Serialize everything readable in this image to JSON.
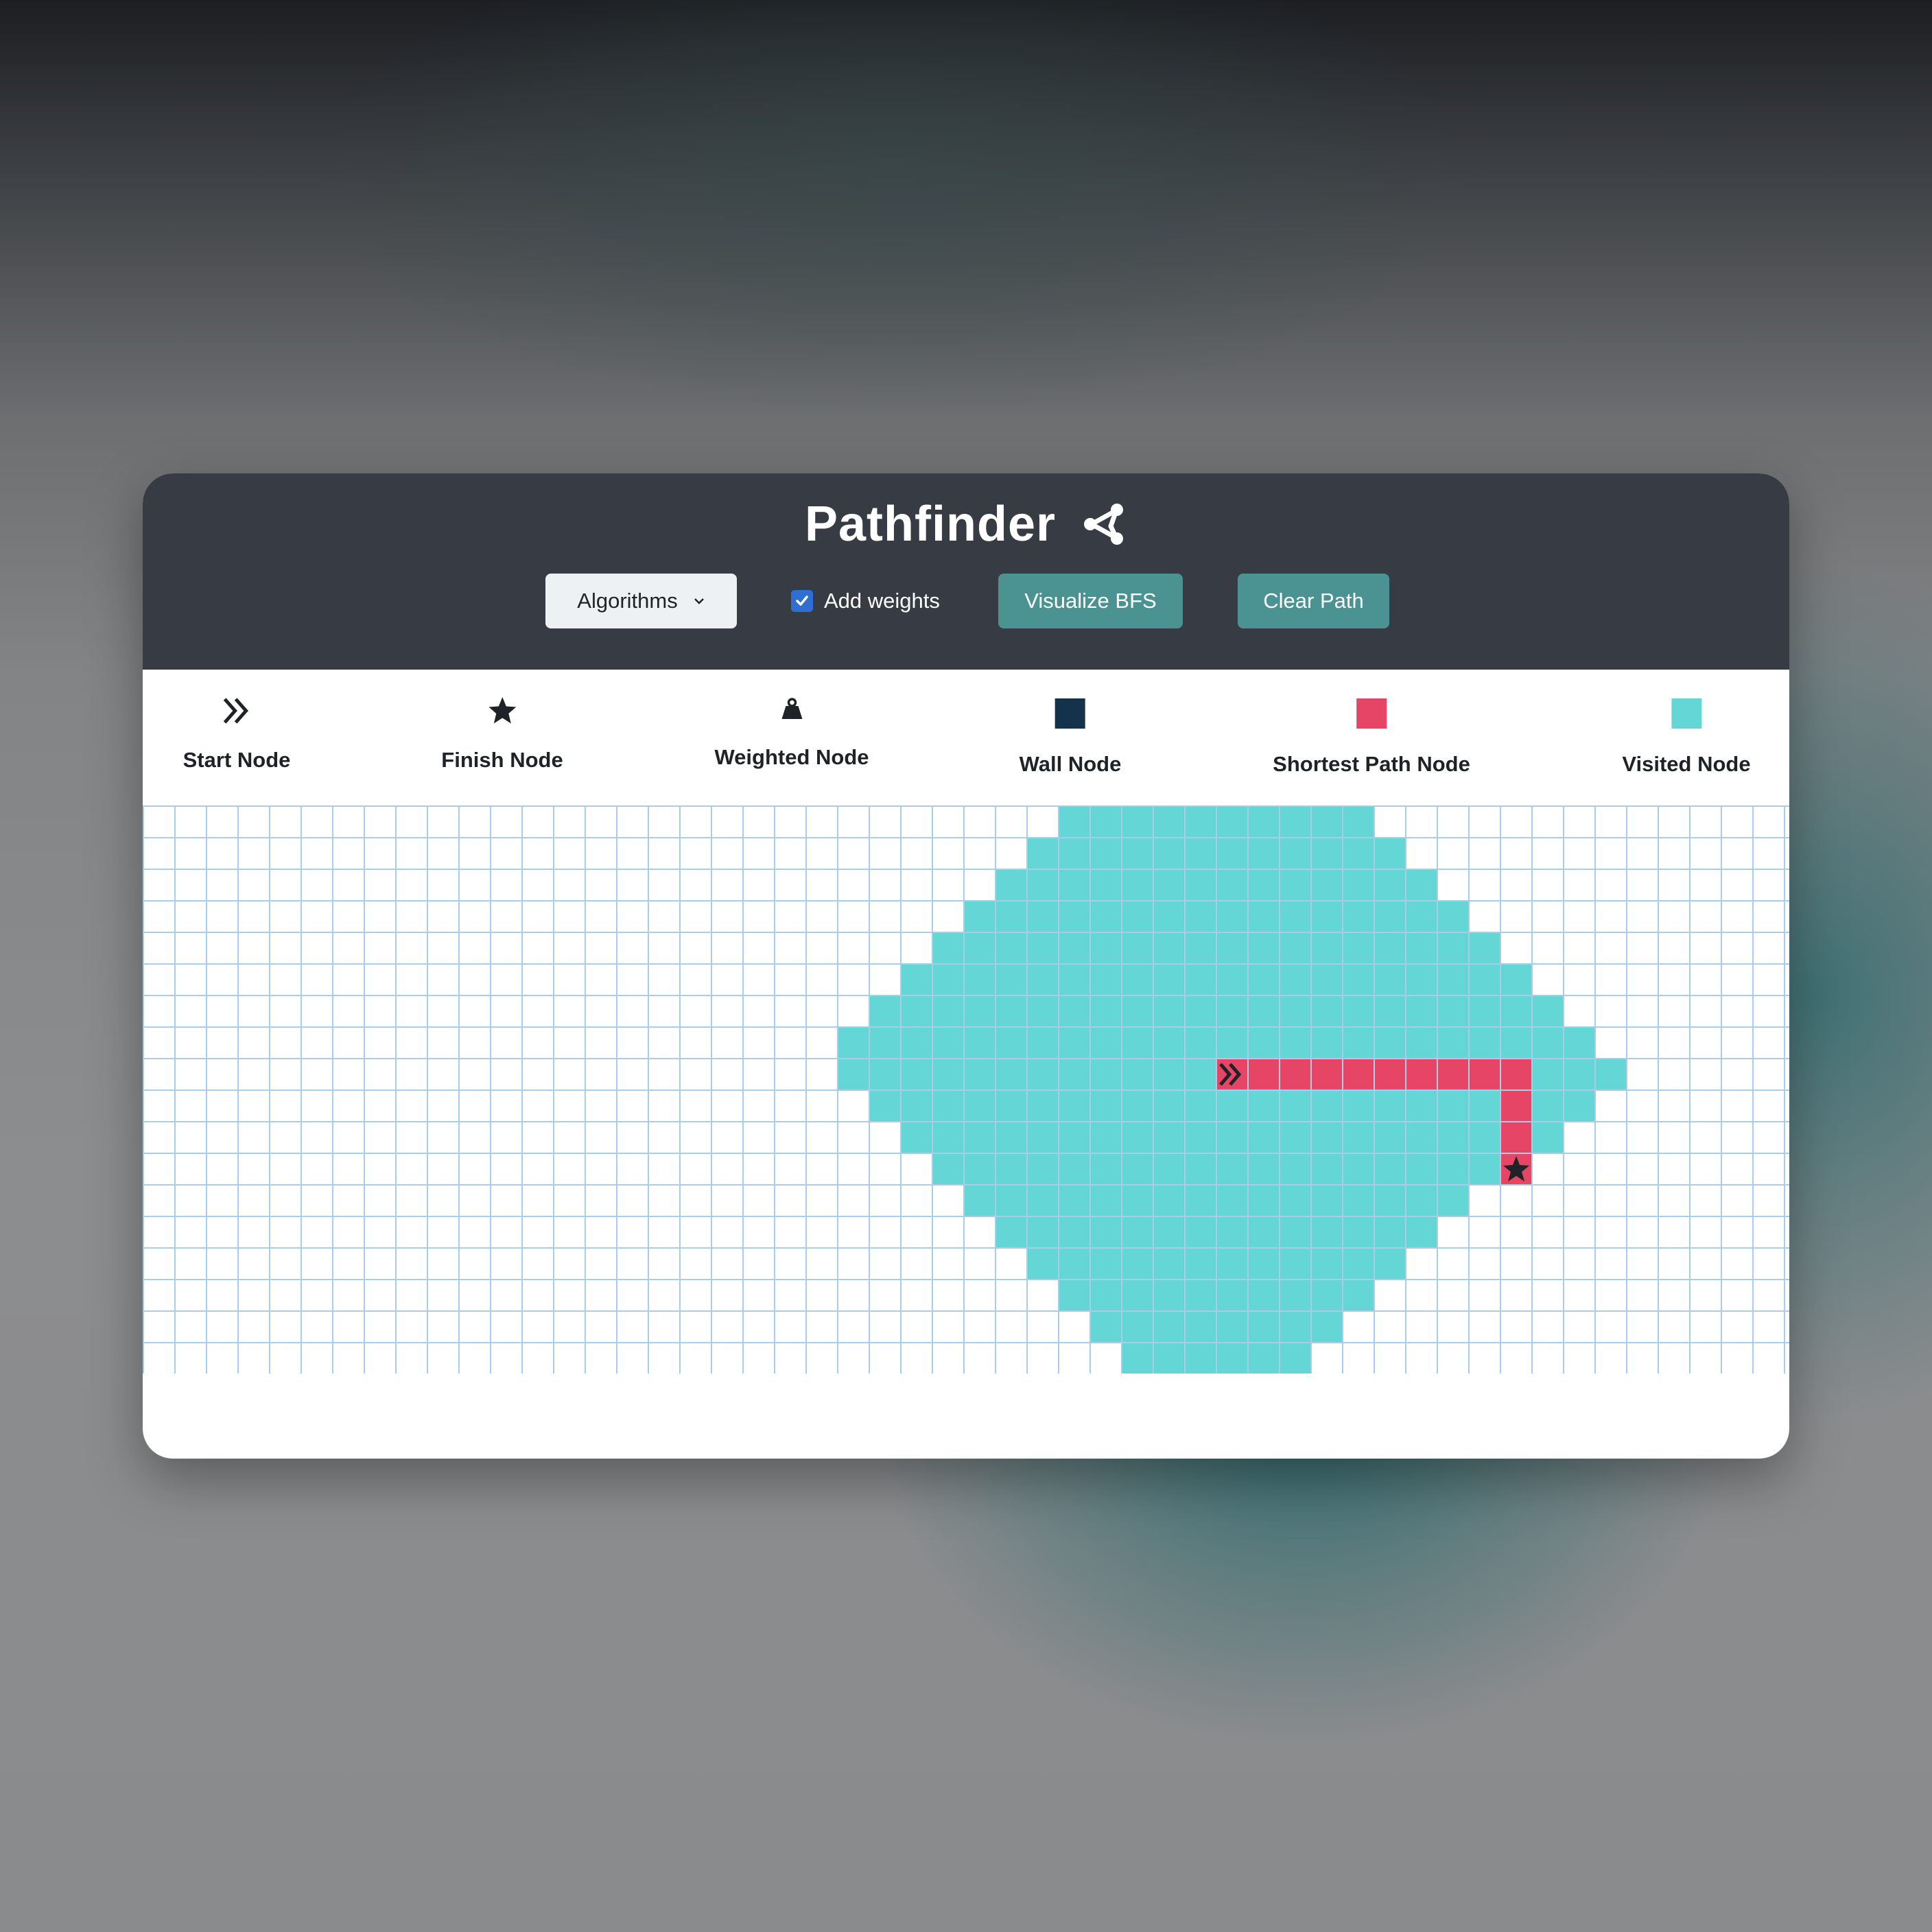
{
  "app": {
    "title": "Pathfinder",
    "title_icon": "share-nodes-icon"
  },
  "controls": {
    "algorithms_label": "Algorithms",
    "add_weights_label": "Add weights",
    "add_weights_checked": true,
    "visualize_label": "Visualize BFS",
    "clear_label": "Clear Path"
  },
  "legend": [
    {
      "label": "Start Node",
      "icon": "double-chevron-right-icon"
    },
    {
      "label": "Finish Node",
      "icon": "star-icon"
    },
    {
      "label": "Weighted Node",
      "icon": "weight-icon"
    },
    {
      "label": "Wall Node",
      "icon": "wall-swatch",
      "color": "#14324a"
    },
    {
      "label": "Shortest Path Node",
      "icon": "path-swatch",
      "color": "#e64566"
    },
    {
      "label": "Visited Node",
      "icon": "visited-swatch",
      "color": "#64d6d6"
    }
  ],
  "colors": {
    "header_bg": "#373c44",
    "accent_button": "#4b9392",
    "visited": "#64d6d6",
    "path": "#e64566",
    "wall": "#14324a",
    "grid_line": "#a9cde6"
  },
  "grid": {
    "rows": 18,
    "cols": 53,
    "start": [
      8,
      34
    ],
    "finish": [
      11,
      43
    ],
    "visited_ranges": [
      [
        0,
        29,
        38
      ],
      [
        1,
        28,
        39
      ],
      [
        2,
        27,
        40
      ],
      [
        3,
        26,
        41
      ],
      [
        4,
        25,
        42
      ],
      [
        5,
        24,
        43
      ],
      [
        6,
        23,
        44
      ],
      [
        7,
        22,
        45
      ],
      [
        8,
        22,
        46
      ],
      [
        9,
        23,
        45
      ],
      [
        10,
        24,
        44
      ],
      [
        11,
        25,
        42
      ],
      [
        12,
        26,
        41
      ],
      [
        13,
        27,
        40
      ],
      [
        14,
        28,
        39
      ],
      [
        15,
        29,
        38
      ],
      [
        16,
        30,
        37
      ],
      [
        17,
        31,
        36
      ]
    ],
    "path": [
      [
        8,
        34
      ],
      [
        8,
        35
      ],
      [
        8,
        36
      ],
      [
        8,
        37
      ],
      [
        8,
        38
      ],
      [
        8,
        39
      ],
      [
        8,
        40
      ],
      [
        8,
        41
      ],
      [
        8,
        42
      ],
      [
        8,
        43
      ],
      [
        9,
        43
      ],
      [
        10,
        43
      ],
      [
        11,
        43
      ]
    ]
  }
}
